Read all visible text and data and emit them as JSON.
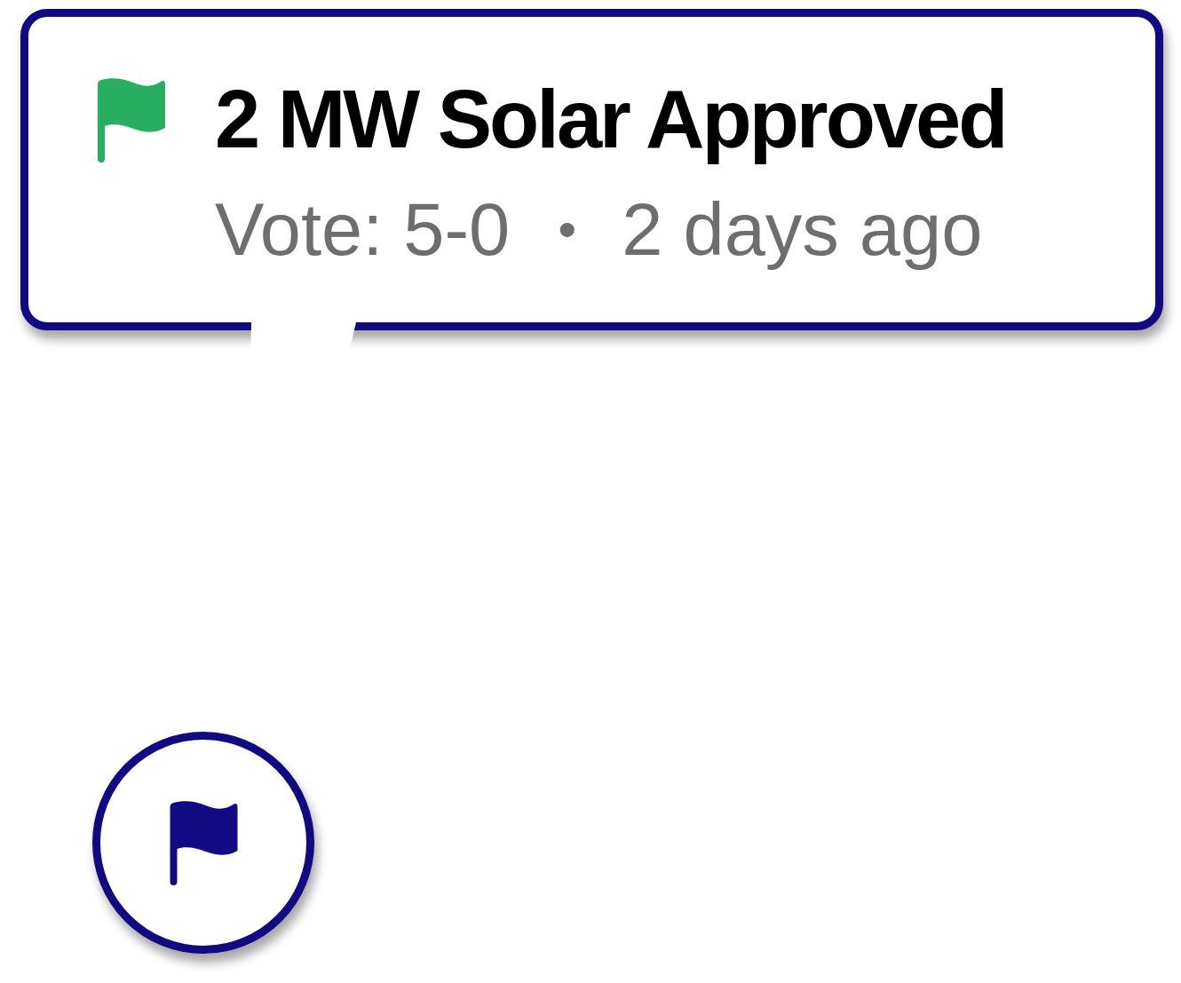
{
  "callout": {
    "title": "2 MW Solar Approved",
    "vote": "Vote: 5-0",
    "separator": "•",
    "time": "2 days ago"
  }
}
